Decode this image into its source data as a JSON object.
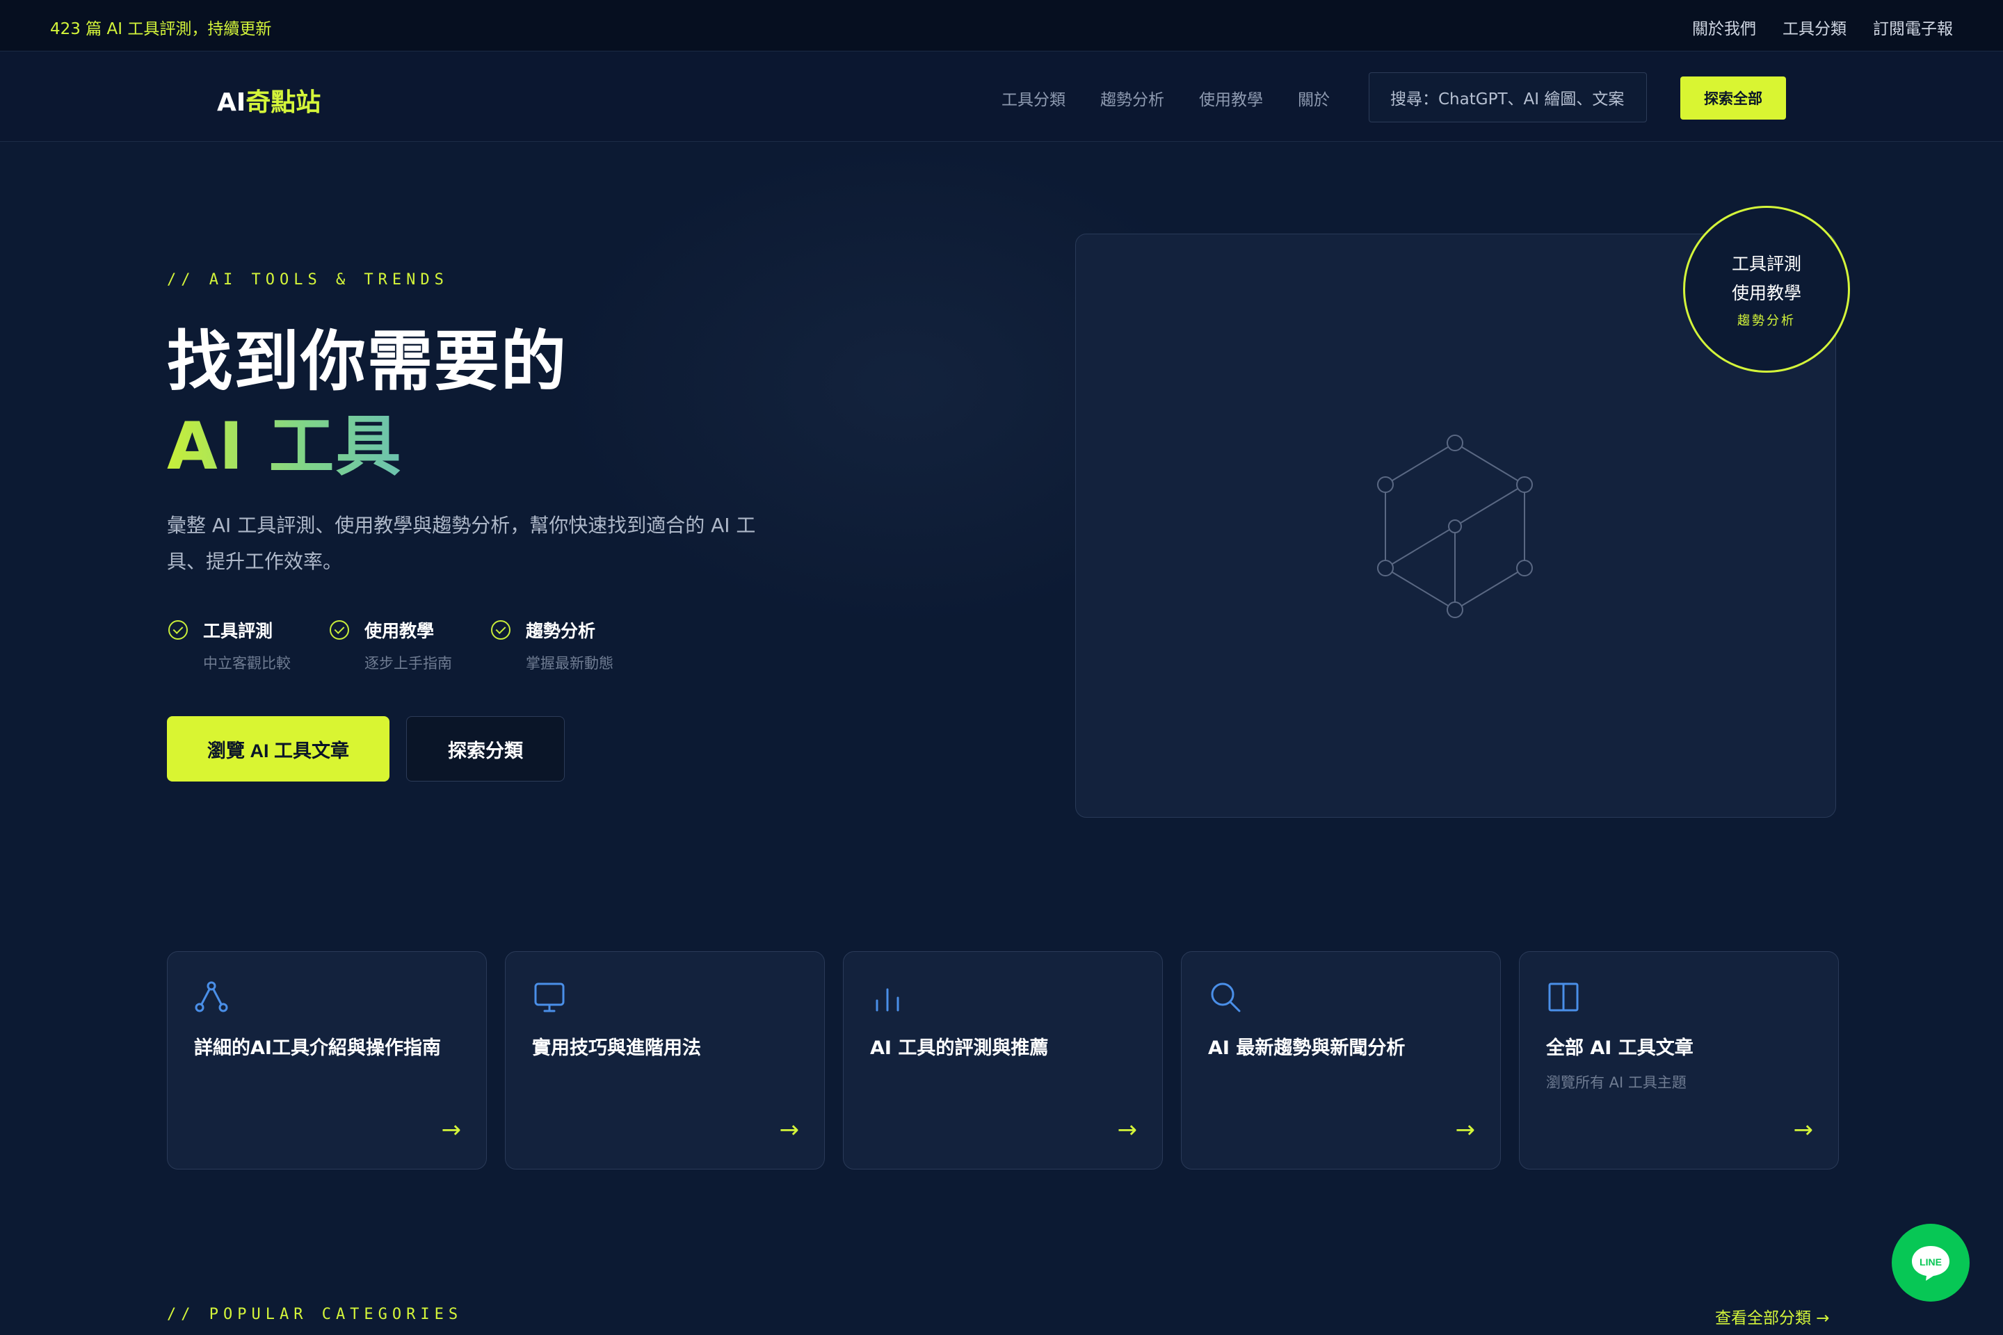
{
  "topbar": {
    "announcement": "423 篇 AI 工具評測，持續更新",
    "links": [
      "關於我們",
      "工具分類",
      "訂閱電子報"
    ]
  },
  "navbar": {
    "logo_prefix": "AI",
    "logo_highlight": "奇點站",
    "items": [
      "工具分類",
      "趨勢分析",
      "使用教學",
      "關於"
    ],
    "search_placeholder": "搜尋：ChatGPT、AI 繪圖、文案",
    "explore_button": "探索全部"
  },
  "hero": {
    "eyebrow": "// AI TOOLS & TRENDS",
    "title_line1": "找到你需要的",
    "title_line2": "AI 工具",
    "description": "彙整 AI 工具評測、使用教學與趨勢分析，幫你快速找到適合的 AI 工具、提升工作效率。",
    "features": [
      {
        "title": "工具評測",
        "subtitle": "中立客觀比較"
      },
      {
        "title": "使用教學",
        "subtitle": "逐步上手指南"
      },
      {
        "title": "趨勢分析",
        "subtitle": "掌握最新動態"
      }
    ],
    "primary_button": "瀏覽 AI 工具文章",
    "secondary_button": "探索分類"
  },
  "badge": {
    "line1": "工具評測",
    "line2": "使用教學",
    "line3": "趨勢分析",
    "accent_color": "#d4f53a"
  },
  "cards": [
    {
      "icon": "share-nodes-icon",
      "title": "詳細的AI工具介紹與操作指南",
      "subtitle": "",
      "arrow": "→"
    },
    {
      "icon": "monitor-icon",
      "title": "實用技巧與進階用法",
      "subtitle": "",
      "arrow": "→"
    },
    {
      "icon": "bar-chart-icon",
      "title": "AI 工具的評測與推薦",
      "subtitle": "",
      "arrow": "→"
    },
    {
      "icon": "search-icon",
      "title": "AI 最新趨勢與新聞分析",
      "subtitle": "",
      "arrow": "→"
    },
    {
      "icon": "book-icon",
      "title": "全部 AI 工具文章",
      "subtitle": "瀏覽所有 AI 工具主題",
      "arrow": "→"
    }
  ],
  "popular": {
    "eyebrow": "// POPULAR CATEGORIES",
    "view_all": "查看全部分類 →"
  },
  "line_chat": {
    "label": "LINE",
    "color": "#07c755"
  },
  "colors": {
    "accent": "#d9f532",
    "background": "#0c1a33",
    "card": "#13223d",
    "icon_blue": "#4a8fe8"
  }
}
